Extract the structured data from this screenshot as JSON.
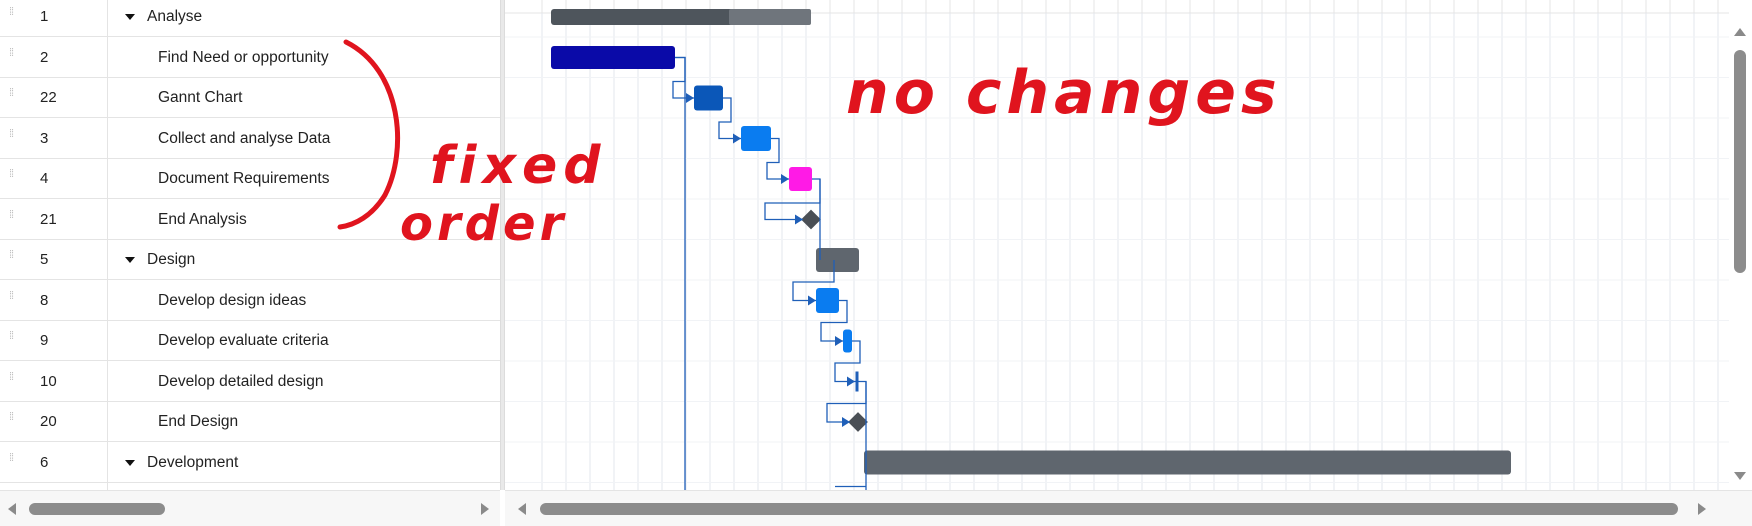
{
  "grid": {
    "rows": [
      {
        "id": "1",
        "name": "Analyse",
        "level": 0,
        "parent": true
      },
      {
        "id": "2",
        "name": "Find Need or opportunity",
        "level": 1,
        "parent": false
      },
      {
        "id": "22",
        "name": "Gannt Chart",
        "level": 1,
        "parent": false
      },
      {
        "id": "3",
        "name": "Collect and analyse Data",
        "level": 1,
        "parent": false
      },
      {
        "id": "4",
        "name": "Document Requirements",
        "level": 1,
        "parent": false
      },
      {
        "id": "21",
        "name": "End Analysis",
        "level": 1,
        "parent": false
      },
      {
        "id": "5",
        "name": "Design",
        "level": 0,
        "parent": true
      },
      {
        "id": "8",
        "name": "Develop design ideas",
        "level": 1,
        "parent": false
      },
      {
        "id": "9",
        "name": "Develop evaluate criteria",
        "level": 1,
        "parent": false
      },
      {
        "id": "10",
        "name": "Develop detailed design",
        "level": 1,
        "parent": false
      },
      {
        "id": "20",
        "name": "End Design",
        "level": 1,
        "parent": false
      },
      {
        "id": "6",
        "name": "Development",
        "level": 0,
        "parent": true
      }
    ]
  },
  "colors": {
    "summary": "#5f666e",
    "summary_dark": "#4e555c",
    "task_navy": "#0a0aa8",
    "task_darkblue": "#0b57b8",
    "task_blue": "#0a7cf0",
    "task_magenta": "#ff1ae6",
    "milestone": "#4a4f55",
    "link": "#1f5fb8",
    "annotation": "#e0141e",
    "gridline": "#e3e7ee"
  },
  "annotations": {
    "left_note_line1": "fixed",
    "left_note_line2": "order",
    "right_note": "no changes"
  }
}
